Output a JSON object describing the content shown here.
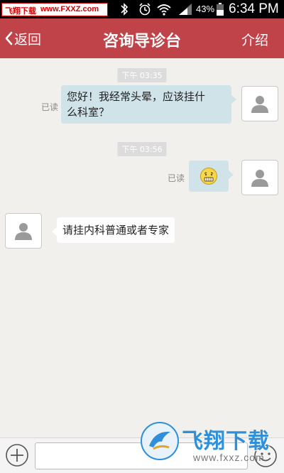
{
  "status_bar": {
    "watermark_cn": "飞翔下载",
    "watermark_url": "www.FXXZ.com",
    "battery": "43%",
    "time": "6:34 PM"
  },
  "header": {
    "back_label": "返回",
    "title": "咨询导诊台",
    "intro_label": "介绍",
    "bg_color": "#c0434a"
  },
  "chat": {
    "messages": [
      {
        "time": "下午 03:35",
        "sender": "me",
        "text": "您好！我经常头晕，应该挂什么科室？",
        "line1": "您好！我经常头晕，应该挂什",
        "line2": "么科室？",
        "read": "已读"
      },
      {
        "time": "下午 03:56",
        "sender": "me",
        "emoji": "grimace-emoji-icon",
        "read": "已读"
      },
      {
        "sender": "other",
        "text": "请挂内科普通或者专家"
      }
    ]
  },
  "input_bar": {
    "value": "",
    "placeholder": ""
  },
  "watermark_logo": {
    "cn": "飞翔下载",
    "url": "www.fxxz.com"
  }
}
